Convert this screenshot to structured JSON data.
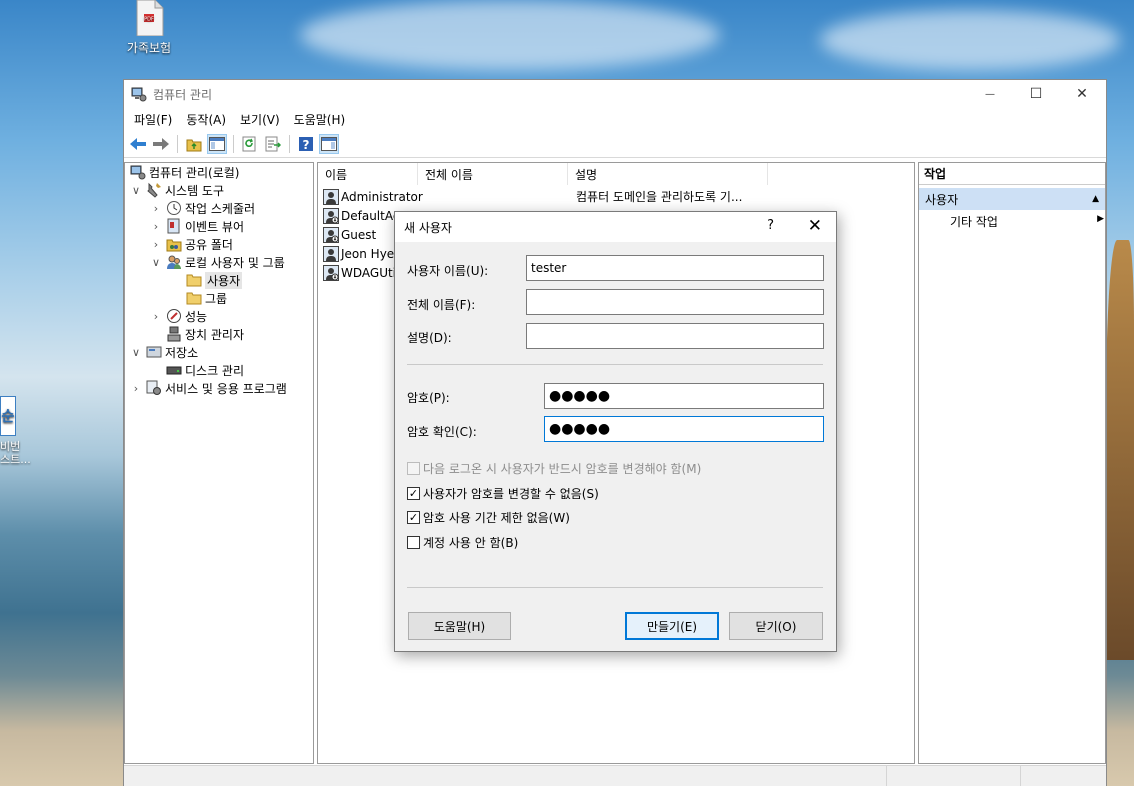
{
  "desktop": {
    "icons": [
      {
        "label": "가족보험"
      },
      {
        "label1": "비번",
        "label2": "스트..."
      }
    ]
  },
  "window": {
    "title": "컴퓨터 관리",
    "controls": {
      "minimize": "—",
      "maximize": "☐",
      "close": "✕"
    },
    "menu": [
      "파일(F)",
      "동작(A)",
      "보기(V)",
      "도움말(H)"
    ]
  },
  "tree": [
    {
      "label": "컴퓨터 관리(로컬)",
      "chev": "",
      "icon": "computer-management-icon"
    },
    {
      "label": "시스템 도구",
      "chev": "∨",
      "icon": "system-tools-icon"
    },
    {
      "label": "작업 스케줄러",
      "chev": "›",
      "icon": "task-scheduler-icon"
    },
    {
      "label": "이벤트 뷰어",
      "chev": "›",
      "icon": "event-viewer-icon"
    },
    {
      "label": "공유 폴더",
      "chev": "›",
      "icon": "shared-folders-icon"
    },
    {
      "label": "로컬 사용자 및 그룹",
      "chev": "∨",
      "icon": "local-users-groups-icon"
    },
    {
      "label": "사용자",
      "chev": "",
      "icon": "folder-icon"
    },
    {
      "label": "그룹",
      "chev": "",
      "icon": "folder-icon"
    },
    {
      "label": "성능",
      "chev": "›",
      "icon": "performance-icon"
    },
    {
      "label": "장치 관리자",
      "chev": "",
      "icon": "device-manager-icon"
    },
    {
      "label": "저장소",
      "chev": "∨",
      "icon": "storage-icon"
    },
    {
      "label": "디스크 관리",
      "chev": "",
      "icon": "disk-management-icon"
    },
    {
      "label": "서비스 및 응용 프로그램",
      "chev": "›",
      "icon": "services-applications-icon"
    }
  ],
  "list": {
    "columns": [
      "이름",
      "전체 이름",
      "설명"
    ],
    "rows": [
      {
        "name": "Administrator",
        "full": "",
        "desc": "컴퓨터 도메인을 관리하도록 기..."
      },
      {
        "name": "DefaultAc",
        "full": "",
        "desc": ""
      },
      {
        "name": "Guest",
        "full": "",
        "desc": ""
      },
      {
        "name": "Jeon Hyeo",
        "full": "",
        "desc": ""
      },
      {
        "name": "WDAGUtil",
        "full": "",
        "desc": ""
      }
    ]
  },
  "actions": {
    "header": "작업",
    "section": "사용자",
    "section_arrow": "▲",
    "item": "기타 작업",
    "item_arrow": "▶"
  },
  "dialog": {
    "title": "새 사용자",
    "help_glyph": "?",
    "close_glyph": "✕",
    "username_label": "사용자 이름(U):",
    "username_value": "tester",
    "fullname_label": "전체 이름(F):",
    "fullname_value": "",
    "desc_label": "설명(D):",
    "desc_value": "",
    "password_label": "암호(P):",
    "password_value": "●●●●●",
    "confirm_label": "암호 확인(C):",
    "confirm_value": "●●●●●",
    "checkboxes": [
      {
        "label": "다음 로그온 시 사용자가 반드시 암호를 변경해야 함(M)",
        "checked": false,
        "disabled": true
      },
      {
        "label": "사용자가 암호를 변경할 수 없음(S)",
        "checked": true,
        "disabled": false
      },
      {
        "label": "암호 사용 기간 제한 없음(W)",
        "checked": true,
        "disabled": false
      },
      {
        "label": "계정 사용 안 함(B)",
        "checked": false,
        "disabled": false
      }
    ],
    "check_glyph": "✓",
    "help_button": "도움말(H)",
    "create_button": "만들기(E)",
    "close_button": "닫기(O)"
  },
  "colors": {
    "accent": "#0078d7",
    "selection": "#cde0f5"
  }
}
